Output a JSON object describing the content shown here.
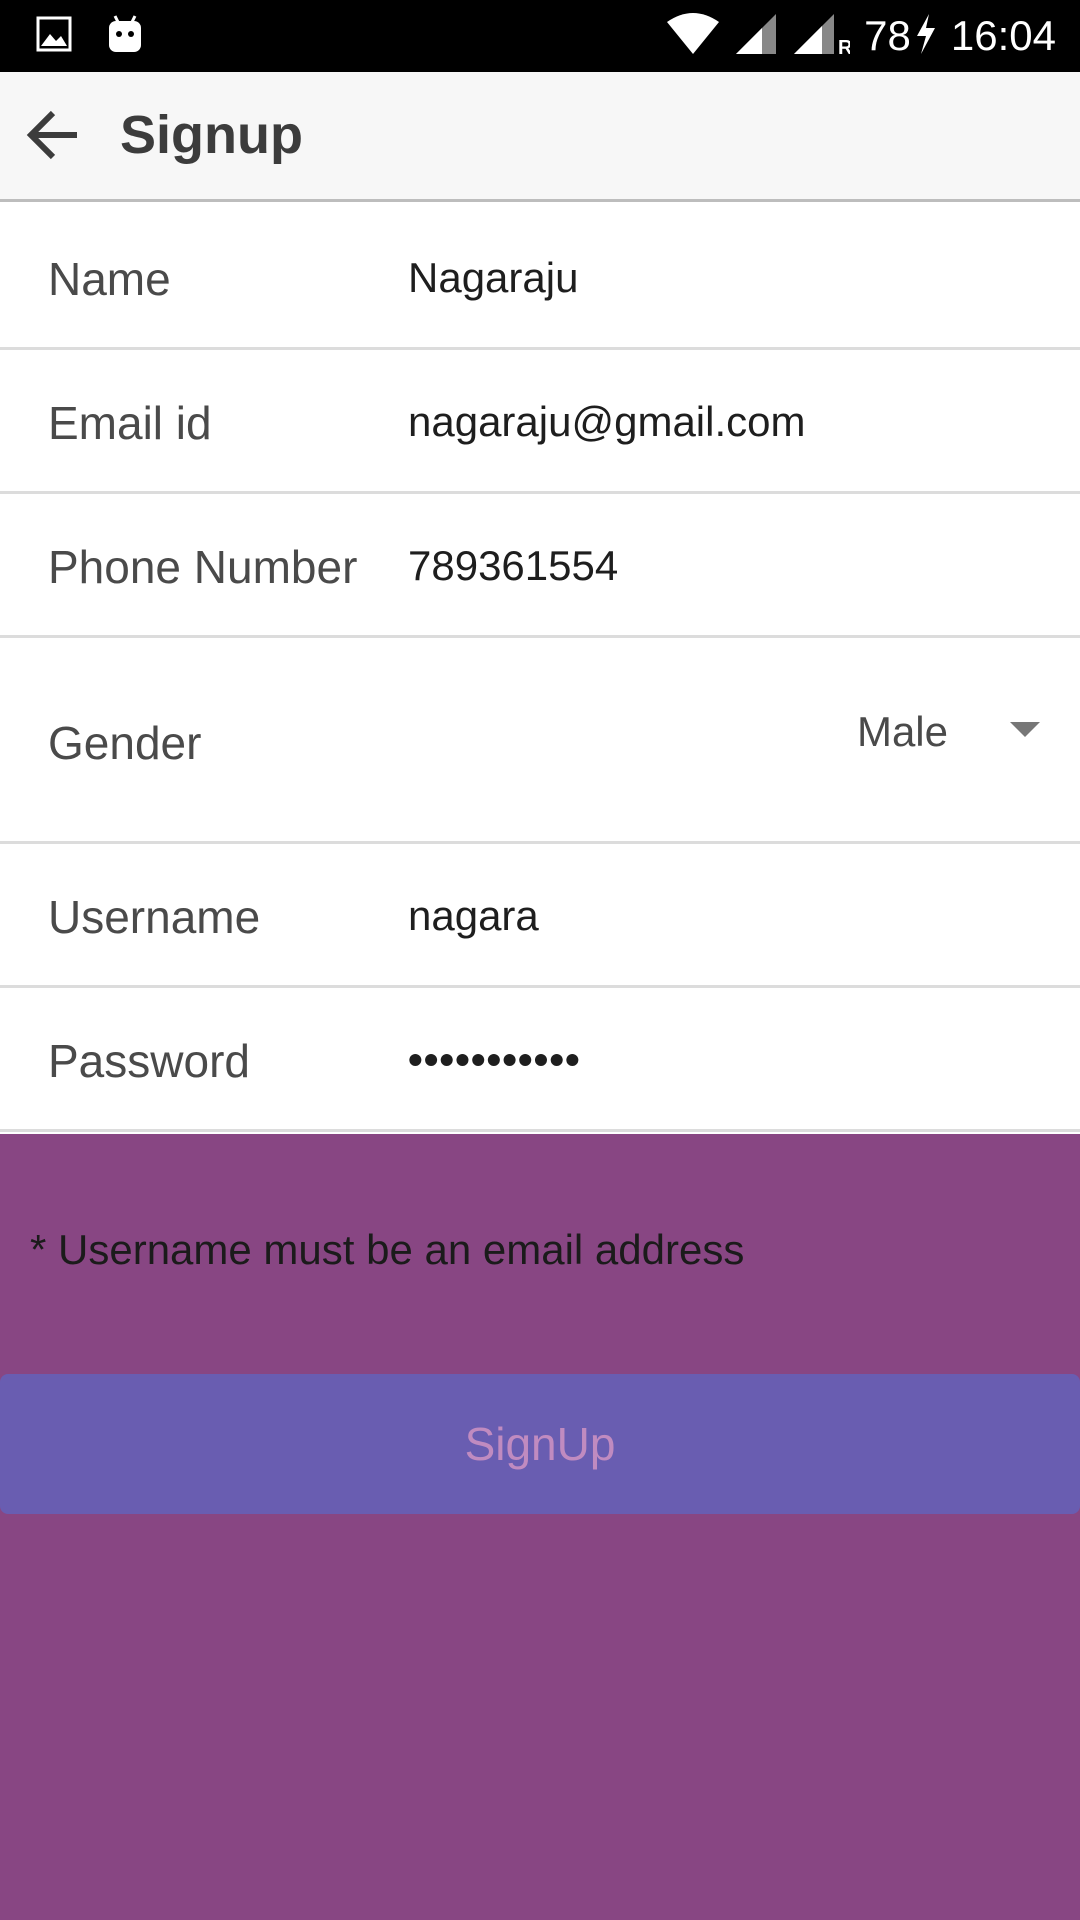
{
  "status_bar": {
    "battery": "78",
    "time": "16:04",
    "icons": [
      "image-icon",
      "android-icon",
      "wifi-icon",
      "signal-icon",
      "roaming-signal-icon",
      "charging-icon"
    ],
    "roaming_label": "R"
  },
  "appbar": {
    "title": "Signup",
    "back_icon": "arrow-back-icon"
  },
  "form": {
    "name": {
      "label": "Name",
      "value": "Nagaraju"
    },
    "email": {
      "label": "Email id",
      "value": "nagaraju@gmail.com"
    },
    "phone": {
      "label": "Phone Number",
      "value": "789361554"
    },
    "gender": {
      "label": "Gender",
      "value": "Male",
      "icon": "dropdown-arrow-icon"
    },
    "username": {
      "label": "Username",
      "value": "nagara"
    },
    "password": {
      "label": "Password",
      "value": "•••••••••••"
    }
  },
  "hint": "* Username must be an email address",
  "signup_button": {
    "label": "SignUp"
  },
  "colors": {
    "bottom_bg": "#884683",
    "button_bg": "#695db1",
    "button_text": "#c08bc0"
  }
}
